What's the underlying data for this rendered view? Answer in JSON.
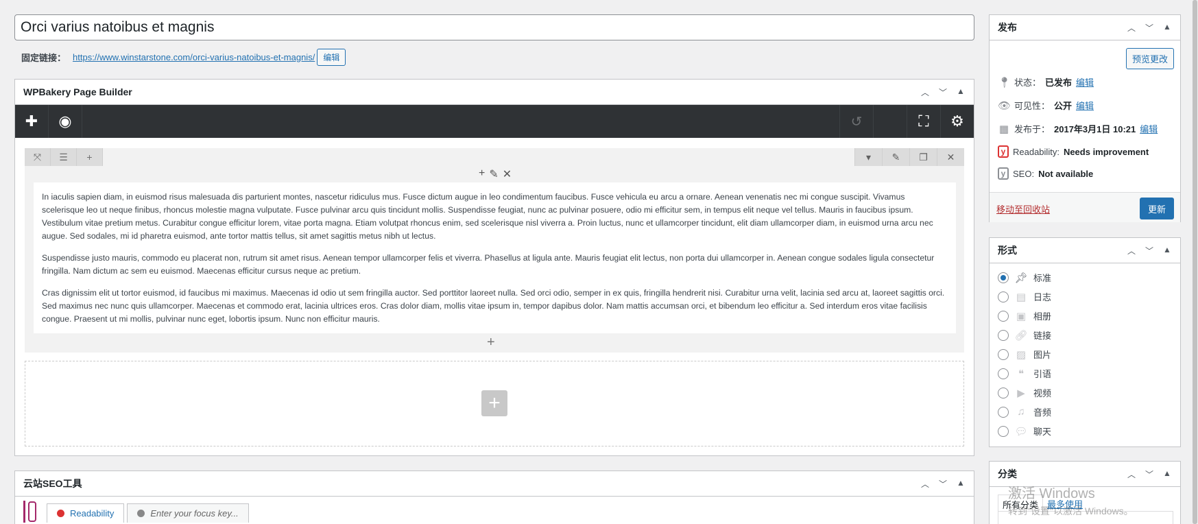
{
  "post": {
    "title": "Orci varius natoibus et magnis",
    "permalink_label": "固定链接：",
    "permalink_base": "https://www.winstarstone.com/",
    "permalink_slug": "orci-varius-natoibus-et-magnis/",
    "permalink_edit": "编辑"
  },
  "wpbakery": {
    "title": "WPBakery Page Builder",
    "paragraphs": [
      "In iaculis sapien diam, in euismod risus malesuada dis parturient montes, nascetur ridiculus mus. Fusce dictum augue in leo condimentum faucibus. Fusce vehicula eu arcu a ornare. Aenean venenatis nec mi congue suscipit. Vivamus scelerisque leo ut neque finibus, rhoncus molestie magna vulputate. Fusce pulvinar arcu quis tincidunt mollis. Suspendisse feugiat, nunc ac pulvinar posuere, odio mi efficitur sem, in tempus elit neque vel tellus. Mauris in faucibus ipsum. Vestibulum vitae pretium metus. Curabitur congue efficitur lorem, vitae porta magna. Etiam volutpat rhoncus enim, sed scelerisque nisl viverra a. Proin luctus, nunc et ullamcorper tincidunt, elit diam ullamcorper diam, in euismod urna arcu nec augue. Sed sodales, mi id pharetra euismod, ante tortor mattis tellus, sit amet sagittis metus nibh ut lectus.",
      "Suspendisse justo mauris, commodo eu placerat non, rutrum sit amet risus. Aenean tempor ullamcorper felis et viverra. Phasellus at ligula ante. Mauris feugiat elit lectus, non porta dui ullamcorper in. Aenean congue sodales ligula consectetur fringilla. Nam dictum ac sem eu euismod. Maecenas efficitur cursus neque ac pretium.",
      "Cras dignissim elit ut tortor euismod, id faucibus mi maximus. Maecenas id odio ut sem fringilla auctor. Sed porttitor laoreet nulla. Sed orci odio, semper in ex quis, fringilla hendrerit nisi. Curabitur urna velit, lacinia sed arcu at, laoreet sagittis orci. Sed maximus nec nunc quis ullamcorper. Maecenas et commodo erat, lacinia ultrices eros. Cras dolor diam, mollis vitae ipsum in, tempor dapibus dolor. Nam mattis accumsan orci, et bibendum leo efficitur a. Sed interdum eros vitae facilisis congue. Praesent ut mi mollis, pulvinar nunc eget, lobortis ipsum. Nunc non efficitur mauris."
    ]
  },
  "seo_box": {
    "title": "云站SEO工具",
    "tab_readability": "Readability",
    "tab_focus_placeholder": "Enter your focus key..."
  },
  "publish": {
    "title": "发布",
    "preview_button": "预览更改",
    "status_label": "状态：",
    "status_value": "已发布",
    "visibility_label": "可见性：",
    "visibility_value": "公开",
    "published_label": "发布于：",
    "published_value": "2017年3月1日 10:21",
    "edit_link": "编辑",
    "readability_label": "Readability:",
    "readability_value": "Needs improvement",
    "seo_label": "SEO:",
    "seo_value": "Not available",
    "trash_link": "移动至回收站",
    "update_button": "更新"
  },
  "format": {
    "title": "形式",
    "options": [
      "标准",
      "日志",
      "相册",
      "链接",
      "图片",
      "引语",
      "视频",
      "音频",
      "聊天"
    ],
    "selected": "标准"
  },
  "category": {
    "title": "分类",
    "tab_all": "所有分类",
    "tab_most_used": "最多使用"
  },
  "watermark": {
    "line1": "激活 Windows",
    "line2": "转到\"设置\"以激活 Windows。"
  },
  "colors": {
    "accent": "#2271b1",
    "toolbar_dark": "#2f3235",
    "danger": "#b32d2e",
    "yoast_red": "#dc3232"
  }
}
